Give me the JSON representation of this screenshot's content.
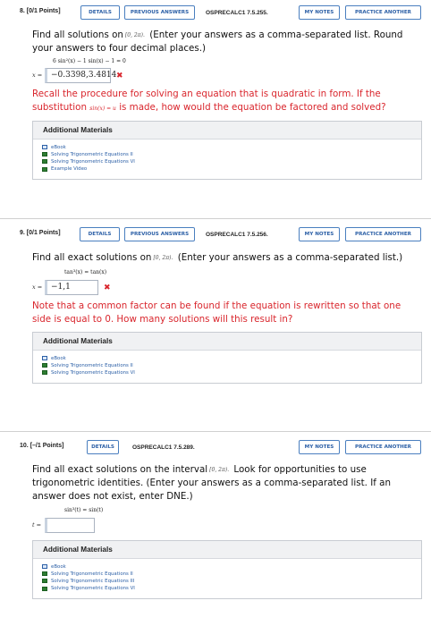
{
  "q8": {
    "number": "8.",
    "points": "[0/1 Points]",
    "details": "DETAILS",
    "previous": "PREVIOUS ANSWERS",
    "code": "OSPRECALC1 7.5.255.",
    "mynotes": "MY NOTES",
    "practice": "PRACTICE ANOTHER",
    "prompt_a": "Find all solutions on",
    "interval": "[0, 2π).",
    "prompt_b": "(Enter your answers as a comma-separated list. Round your answers to four decimal places.)",
    "equation": "6 sin²(x) − 1 sin(x) − 1 = 0",
    "ans_label": "x =",
    "answer": "−0.3398,3.4814",
    "mark": "✖",
    "feedback_a": "Recall the procedure for solving an equation that is quadratic in form. If the substitution",
    "feedback_sub": "sin(x) = u",
    "feedback_b": "is made, how would the equation be factored and solved?",
    "materials_title": "Additional Materials",
    "materials": [
      "eBook",
      "Solving Trigonometric Equations II",
      "Solving Trigonometric Equations VI",
      "Example Video"
    ]
  },
  "q9": {
    "number": "9.",
    "points": "[0/1 Points]",
    "details": "DETAILS",
    "previous": "PREVIOUS ANSWERS",
    "code": "OSPRECALC1 7.5.256.",
    "mynotes": "MY NOTES",
    "practice": "PRACTICE ANOTHER",
    "prompt_a": "Find all exact solutions on",
    "interval": "[0, 2π).",
    "prompt_b": "(Enter your answers as a comma-separated list.)",
    "equation": "tan³(x) = tan(x)",
    "ans_label": "x =",
    "answer": "−1,1",
    "mark": "✖",
    "feedback": "Note that a common factor can be found if the equation is rewritten so that one side is equal to 0. How many solutions will this result in?",
    "materials_title": "Additional Materials",
    "materials": [
      "eBook",
      "Solving Trigonometric Equations II",
      "Solving Trigonometric Equations VI"
    ]
  },
  "q10": {
    "number": "10.",
    "points": "[–/1 Points]",
    "details": "DETAILS",
    "code": "OSPRECALC1 7.5.289.",
    "mynotes": "MY NOTES",
    "practice": "PRACTICE ANOTHER",
    "prompt_a": "Find all exact solutions on the interval",
    "interval": "[0, 2π).",
    "prompt_b": "Look for opportunities to use trigonometric identities. (Enter your answers as a comma-separated list. If an answer does not exist, enter DNE.)",
    "equation": "sin³(t) = sin(t)",
    "ans_label": "t =",
    "answer": "",
    "materials_title": "Additional Materials",
    "materials": [
      "eBook",
      "Solving Trigonometric Equations II",
      "Solving Trigonometric Equations III",
      "Solving Trigonometric Equations VI"
    ]
  }
}
